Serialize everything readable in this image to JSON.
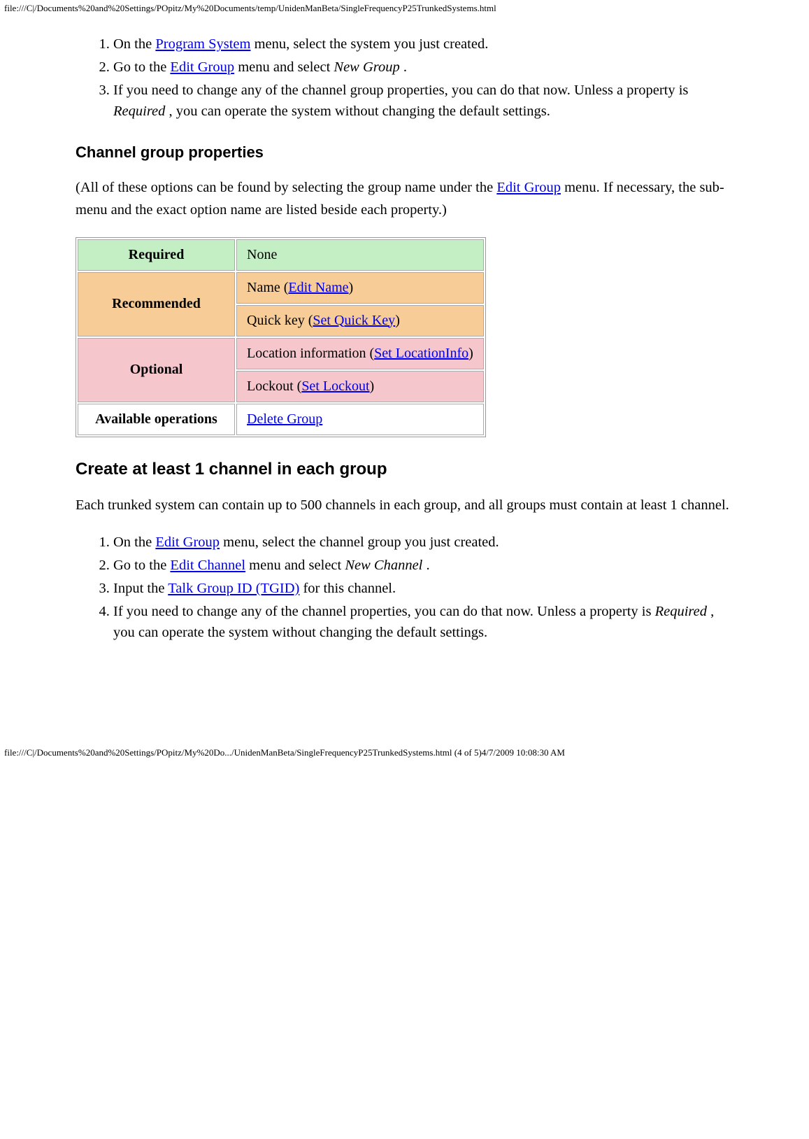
{
  "header_path": "file:///C|/Documents%20and%20Settings/POpitz/My%20Documents/temp/UnidenManBeta/SingleFrequencyP25TrunkedSystems.html",
  "footer_path": "file:///C|/Documents%20and%20Settings/POpitz/My%20Do.../UnidenManBeta/SingleFrequencyP25TrunkedSystems.html (4 of 5)4/7/2009 10:08:30 AM",
  "list1": {
    "item1_a": "On the ",
    "item1_link": "Program System",
    "item1_b": " menu, select the system you just created.",
    "item2_a": "Go to the ",
    "item2_link": "Edit Group",
    "item2_b": " menu and select ",
    "item2_em": "New Group",
    "item2_c": " .",
    "item3_a": "If you need to change any of the channel group properties, you can do that now. Unless a property is ",
    "item3_em": "Required",
    "item3_b": " , you can operate the system without changing the default settings."
  },
  "h_channel_group_props": "Channel group properties",
  "para_group_props_a": "(All of these options can be found by selecting the group name under the ",
  "para_group_props_link": "Edit Group",
  "para_group_props_b": " menu. If necessary, the sub-menu and the exact option name are listed beside each property.)",
  "table": {
    "required_label": "Required",
    "required_value": "None",
    "recommended_label": "Recommended",
    "rec_name_a": "Name (",
    "rec_name_link": "Edit Name",
    "rec_name_b": ")",
    "rec_qk_a": "Quick key (",
    "rec_qk_link": "Set Quick Key",
    "rec_qk_b": ")",
    "optional_label": "Optional",
    "opt_loc_a": "Location information (",
    "opt_loc_link": "Set LocationInfo",
    "opt_loc_b": ")",
    "opt_lock_a": "Lockout (",
    "opt_lock_link": "Set Lockout",
    "opt_lock_b": ")",
    "avail_label": "Available operations",
    "avail_link": "Delete Group"
  },
  "h_create_channel": "Create at least 1 channel in each group",
  "para_create": "Each trunked system can contain up to 500 channels in each group, and all groups must contain at least 1 channel.",
  "list2": {
    "item1_a": "On the ",
    "item1_link": "Edit Group",
    "item1_b": " menu, select the channel group you just created.",
    "item2_a": "Go to the ",
    "item2_link": "Edit Channel",
    "item2_b": " menu and select ",
    "item2_em": "New Channel",
    "item2_c": " .",
    "item3_a": "Input the ",
    "item3_link": "Talk Group ID (TGID)",
    "item3_b": " for this channel.",
    "item4_a": "If you need to change any of the channel properties, you can do that now. Unless a property is ",
    "item4_em": "Required",
    "item4_b": " , you can operate the system without changing the default settings."
  }
}
